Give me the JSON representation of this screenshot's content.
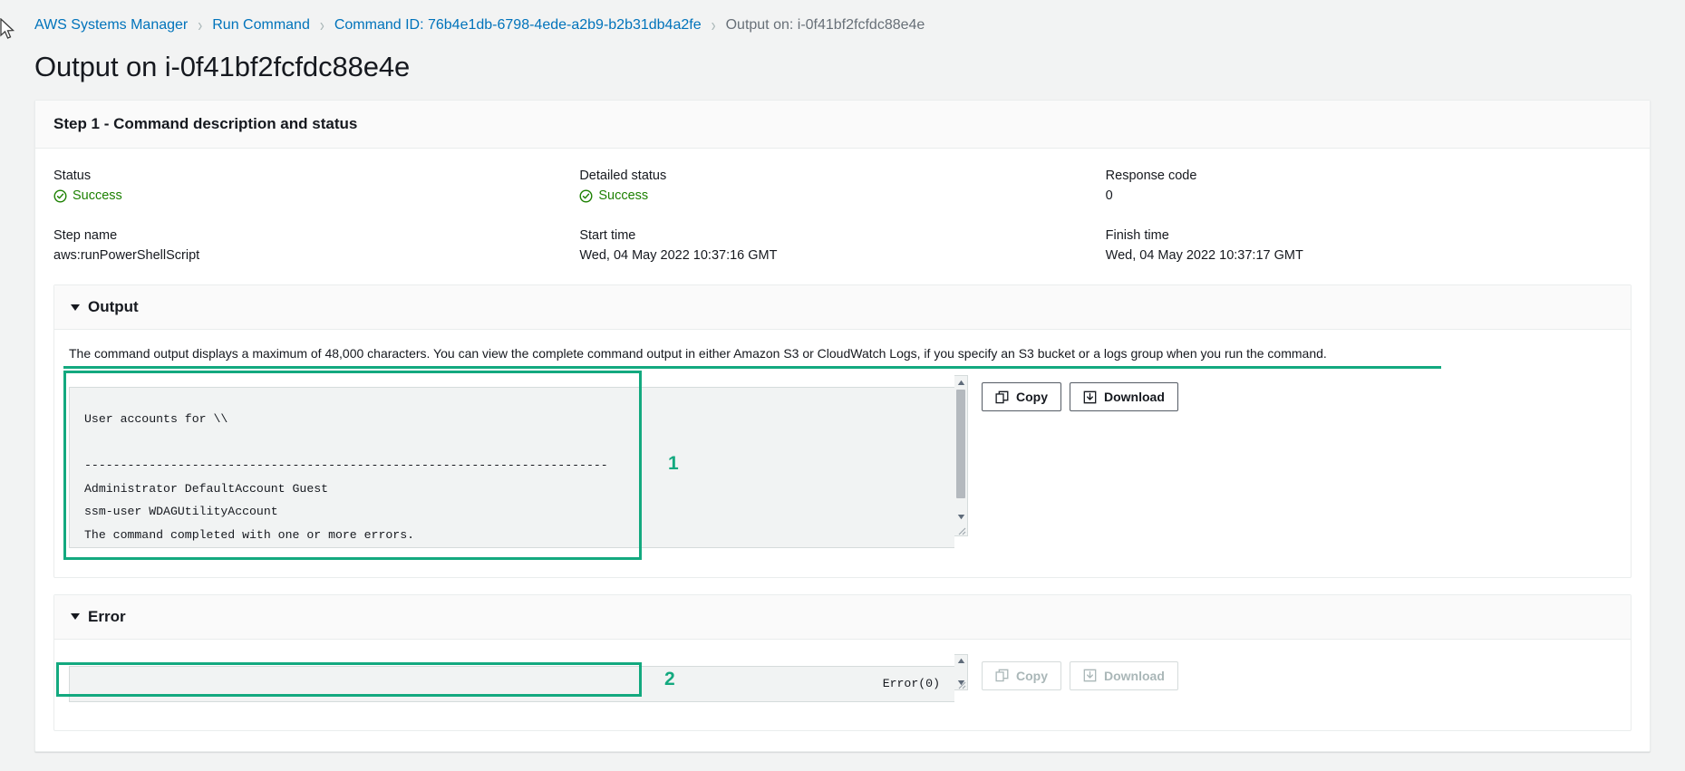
{
  "breadcrumb": {
    "items": [
      {
        "label": "AWS Systems Manager",
        "current": false
      },
      {
        "label": "Run Command",
        "current": false
      },
      {
        "label": "Command ID: 76b4e1db-6798-4ede-a2b9-b2b31db4a2fe",
        "current": false
      },
      {
        "label": "Output on: i-0f41bf2fcfdc88e4e",
        "current": true
      }
    ],
    "separator": "›"
  },
  "page": {
    "title": "Output on i-0f41bf2fcfdc88e4e"
  },
  "step_container": {
    "header": "Step 1 - Command description and status",
    "fields": {
      "status_label": "Status",
      "status_value": "Success",
      "detailed_status_label": "Detailed status",
      "detailed_status_value": "Success",
      "response_code_label": "Response code",
      "response_code_value": "0",
      "step_name_label": "Step name",
      "step_name_value": "aws:runPowerShellScript",
      "start_time_label": "Start time",
      "start_time_value": "Wed, 04 May 2022 10:37:16 GMT",
      "finish_time_label": "Finish time",
      "finish_time_value": "Wed, 04 May 2022 10:37:17 GMT"
    }
  },
  "output_section": {
    "title": "Output",
    "description": "The command output displays a maximum of 48,000 characters. You can view the complete command output in either Amazon S3 or CloudWatch Logs, if you specify an S3 bucket or a logs group when you run the command.",
    "console_text": "User accounts for \\\\\n\n-------------------------------------------------------------------------\nAdministrator DefaultAccount Guest\nssm-user WDAGUtilityAccount\nThe command completed with one or more errors.",
    "copy_label": "Copy",
    "download_label": "Download"
  },
  "error_section": {
    "title": "Error",
    "console_text": "Error(0)",
    "copy_label": "Copy",
    "download_label": "Download"
  },
  "annotations": [
    {
      "number": "1"
    },
    {
      "number": "2"
    }
  ],
  "colors": {
    "accent_teal": "#13a97f",
    "link_blue": "#0073bb",
    "success_green": "#1d8102",
    "text_dark": "#16191f",
    "muted_gray": "#687078"
  }
}
